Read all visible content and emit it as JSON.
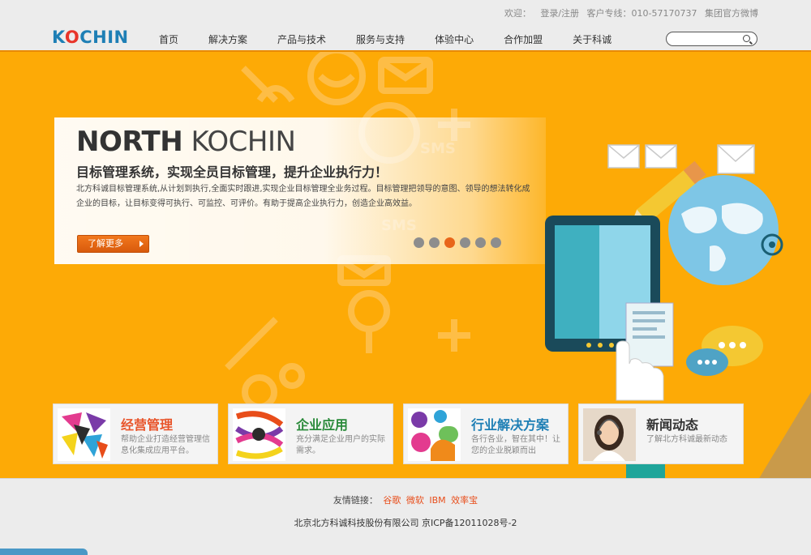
{
  "topbar": {
    "welcome": "欢迎：",
    "login": "登录",
    "slash": "/",
    "register": "注册",
    "hotline": "客户专线：010-57170737",
    "weibo": "集团官方微博"
  },
  "header": {
    "logo": "KOCHIN",
    "nav": [
      "首页",
      "解决方案",
      "产品与技术",
      "服务与支持",
      "体验中心",
      "合作加盟",
      "关于科诚"
    ],
    "search_placeholder": ""
  },
  "hero": {
    "title_bold": "NORTH",
    "title_thin": "KOCHIN",
    "subtitle": "目标管理系统，实现全员目标管理，提升企业执行力！",
    "description": "北方科诚目标管理系统,从计划到执行,全面实时跟进,实现企业目标管理全业务过程。目标管理把领导的意图、领导的想法转化成企业的目标，让目标变得可执行、可监控、可评价。有助于提高企业执行力，创造企业高效益。",
    "more_label": "了解更多",
    "slide_count": 6,
    "active_slide": 3
  },
  "cards": [
    {
      "title": "经营管理",
      "desc": "帮助企业打造经营管理信息化集成应用平台。",
      "color": "#e8542a"
    },
    {
      "title": "企业应用",
      "desc": "充分满足企业用户的实际需求。",
      "color": "#2a8a3a"
    },
    {
      "title": "行业解决方案",
      "desc": "各行各业，智在其中！让您的企业脱颖而出",
      "color": "#1e7fb5"
    },
    {
      "title": "新闻动态",
      "desc": "了解北方科诚最新动态",
      "color": "#333333"
    }
  ],
  "footer": {
    "links_label": "友情链接：",
    "links": [
      "谷歌",
      "微软",
      "IBM",
      "效率宝"
    ],
    "copyright": "北京北方科诚科技股份有限公司 京ICP备12011028号-2"
  },
  "colors": {
    "hero_bg": "#fdaa06",
    "accent": "#e8651a",
    "logo_blue": "#1e7fb5",
    "logo_red": "#e8352a"
  }
}
